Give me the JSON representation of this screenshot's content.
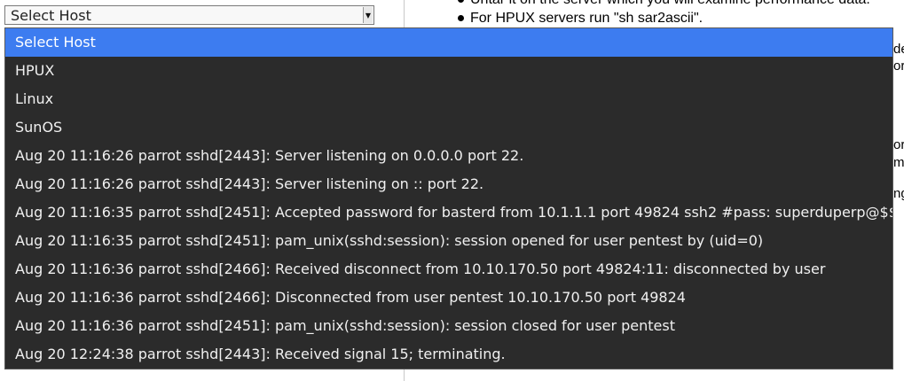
{
  "select": {
    "value": "Select Host"
  },
  "right_content": {
    "bullets": [
      "Untar it on the server which you will examine performance data.",
      "For HPUX servers run \"sh sar2ascii\"."
    ],
    "edge_fragments": [
      "de",
      "or",
      "or",
      "ma",
      "ng"
    ]
  },
  "dropdown": {
    "options": [
      {
        "label": "Select Host",
        "selected": true
      },
      {
        "label": "HPUX",
        "selected": false
      },
      {
        "label": "Linux",
        "selected": false
      },
      {
        "label": "SunOS",
        "selected": false
      },
      {
        "label": "Aug 20 11:16:26 parrot sshd[2443]: Server listening on 0.0.0.0 port 22.",
        "selected": false
      },
      {
        "label": "Aug 20 11:16:26 parrot sshd[2443]: Server listening on :: port 22.",
        "selected": false
      },
      {
        "label": "Aug 20 11:16:35 parrot sshd[2451]: Accepted password for basterd from 10.1.1.1 port 49824 ssh2 #pass: superduperp@$$",
        "selected": false
      },
      {
        "label": "Aug 20 11:16:35 parrot sshd[2451]: pam_unix(sshd:session): session opened for user pentest by (uid=0)",
        "selected": false
      },
      {
        "label": "Aug 20 11:16:36 parrot sshd[2466]: Received disconnect from 10.10.170.50 port 49824:11: disconnected by user",
        "selected": false
      },
      {
        "label": "Aug 20 11:16:36 parrot sshd[2466]: Disconnected from user pentest 10.10.170.50 port 49824",
        "selected": false
      },
      {
        "label": "Aug 20 11:16:36 parrot sshd[2451]: pam_unix(sshd:session): session closed for user pentest",
        "selected": false
      },
      {
        "label": "Aug 20 12:24:38 parrot sshd[2443]: Received signal 15; terminating.",
        "selected": false
      }
    ]
  },
  "colors": {
    "dropdown_bg": "#2b2b2b",
    "selected_bg": "#3d7cf0",
    "option_text": "#f0f0f0"
  }
}
